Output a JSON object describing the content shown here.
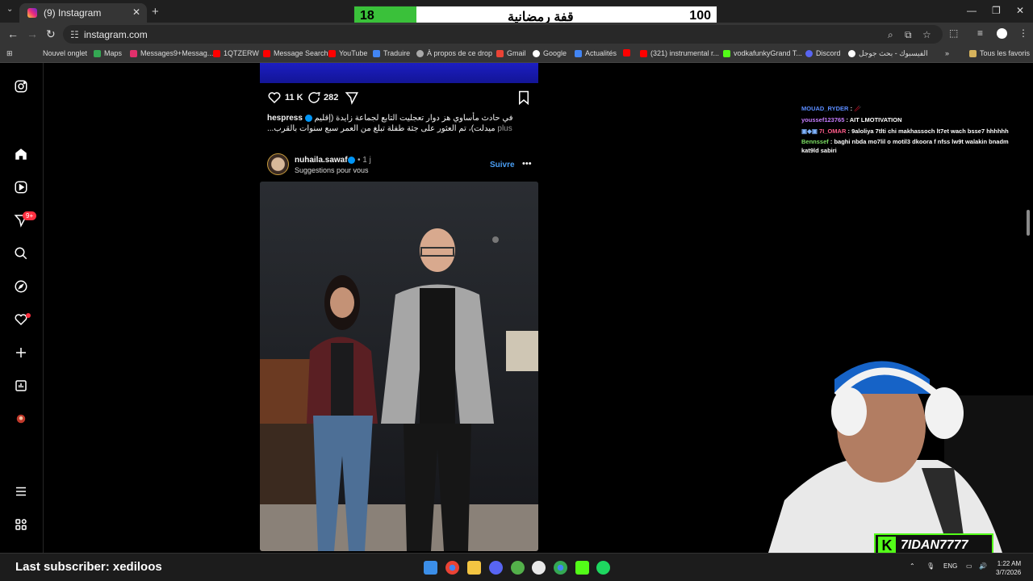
{
  "browser": {
    "tab_title": "(9) Instagram",
    "url": "instagram.com",
    "bookmarks": [
      "Nouvel onglet",
      "Maps",
      "Messages9+Messag...",
      "1QTZERW",
      "Message Search",
      "YouTube",
      "Traduire",
      "À propos de ce drop",
      "Gmail",
      "Google",
      "Actualités",
      "(321) instrumental r...",
      "vodkafunkyGrand T...",
      "Discord",
      "الفيسبوك - بحث جوجل",
      "Tous les favoris"
    ]
  },
  "overlay": {
    "progress_left": "18",
    "progress_title": "قفة رمضانية",
    "progress_right": "100",
    "progress_fraction": 0.18
  },
  "sidebar": {
    "notif_badge": "9+"
  },
  "feed": {
    "likes": "11 K",
    "comments": "282",
    "caption_user": "hespress",
    "caption_text": "في حادث مأساوي هز دوار تعجليت التابع لجماعة زايدة (إقليم ميدلت)، تم العثور على جثة طفلة تبلغ من العمر سبع سنوات بالقرب...",
    "caption_more": "plus",
    "post_user": "nuhaila.sawaf",
    "post_time": "• 1 j",
    "post_sub": "Suggestions pour vous",
    "follow": "Suivre"
  },
  "chat": [
    {
      "user": "MOUAD_RYDER",
      "msg": "",
      "color": "#5b8cff"
    },
    {
      "user": "youssef123765",
      "msg": "AIT LMOTIVATION",
      "color": "#c77dff"
    },
    {
      "user": "7I_OMAR",
      "msg": "9aloliya 7tlti chi makhassoch lt7et wach bsse7 hhhhhh",
      "color": "#ff5c8a"
    },
    {
      "user": "Bennssef",
      "msg": "baghi nbda mo7lil o motil3 dkoora f nfss lw9t walakin bnadm kat9ld sabiri",
      "color": "#7ddf64"
    }
  ],
  "streamer": {
    "kick_name": "7IDAN7777"
  },
  "taskbar": {
    "last_subscriber": "Last subscriber: xediloos",
    "lang": "ENG",
    "time": "1:22 AM",
    "date": "3/7/2026"
  }
}
